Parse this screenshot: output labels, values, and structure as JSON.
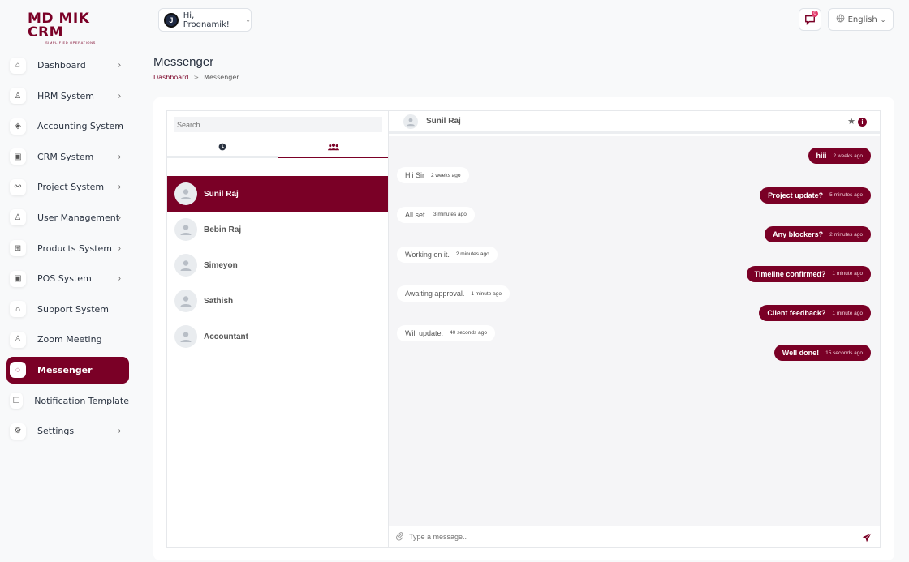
{
  "brand": {
    "logo": "MD MIK CRM",
    "tagline": "SIMPLIFIED OPERATIONS"
  },
  "header": {
    "greeting": "Hi, Prognamik!",
    "avatar_initial": "J",
    "notification_count": "0",
    "language": "English"
  },
  "sidebar": {
    "items": [
      {
        "label": "Dashboard",
        "icon": "home-icon",
        "has_children": true
      },
      {
        "label": "HRM System",
        "icon": "user-icon",
        "has_children": true
      },
      {
        "label": "Accounting System",
        "icon": "box-icon",
        "has_children": true
      },
      {
        "label": "CRM System",
        "icon": "layers-icon",
        "has_children": true
      },
      {
        "label": "Project System",
        "icon": "share-icon",
        "has_children": true
      },
      {
        "label": "User Management",
        "icon": "users-icon",
        "has_children": true
      },
      {
        "label": "Products System",
        "icon": "cart-icon",
        "has_children": true
      },
      {
        "label": "POS System",
        "icon": "layers-icon",
        "has_children": true
      },
      {
        "label": "Support System",
        "icon": "headphones-icon",
        "has_children": false
      },
      {
        "label": "Zoom Meeting",
        "icon": "user-check-icon",
        "has_children": false
      },
      {
        "label": "Messenger",
        "icon": "message-icon",
        "has_children": false,
        "active": true
      },
      {
        "label": "Notification Template",
        "icon": "notification-icon",
        "has_children": false
      },
      {
        "label": "Settings",
        "icon": "gear-icon",
        "has_children": true
      }
    ]
  },
  "page": {
    "title": "Messenger",
    "breadcrumb": {
      "home": "Dashboard",
      "separator": ">",
      "current": "Messenger"
    }
  },
  "messenger": {
    "search_placeholder": "Search",
    "tabs": [
      {
        "icon": "clock-icon"
      },
      {
        "icon": "group-icon",
        "active": true
      }
    ],
    "contacts": [
      {
        "name": "Sunil Raj",
        "active": true
      },
      {
        "name": "Bebin Raj"
      },
      {
        "name": "Simeyon"
      },
      {
        "name": "Sathish"
      },
      {
        "name": "Accountant"
      }
    ],
    "chat_header": {
      "name": "Sunil Raj"
    },
    "messages": [
      {
        "dir": "out",
        "text": "hiii",
        "time": "2 weeks ago"
      },
      {
        "dir": "in",
        "text": "Hii Sir",
        "time": "2 weeks ago"
      },
      {
        "dir": "out",
        "text": "Project update?",
        "time": "5 minutes ago"
      },
      {
        "dir": "in",
        "text": "All set.",
        "time": "3 minutes ago"
      },
      {
        "dir": "out",
        "text": "Any blockers?",
        "time": "2 minutes ago"
      },
      {
        "dir": "in",
        "text": "Working on it.",
        "time": "2 minutes ago"
      },
      {
        "dir": "out",
        "text": "Timeline confirmed?",
        "time": "1 minute ago"
      },
      {
        "dir": "in",
        "text": "Awaiting approval.",
        "time": "1 minute ago"
      },
      {
        "dir": "out",
        "text": "Client feedback?",
        "time": "1 minute ago"
      },
      {
        "dir": "in",
        "text": "Will update.",
        "time": "40 seconds ago"
      },
      {
        "dir": "out",
        "text": "Well done!",
        "time": "15 seconds ago"
      }
    ],
    "composer_placeholder": "Type a message.."
  },
  "colors": {
    "accent": "#7a0026",
    "background": "#f8f9fa",
    "chat_bg": "#f5f5f7"
  }
}
